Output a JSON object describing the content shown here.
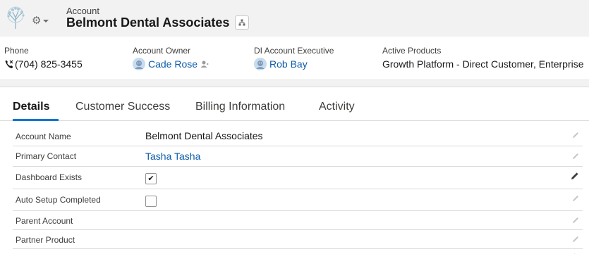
{
  "header": {
    "object_label": "Account",
    "record_title": "Belmont Dental Associates",
    "logo_icon": "tree-logo-icon",
    "settings_icon": "gear-icon",
    "hierarchy_icon": "hierarchy-icon"
  },
  "highlights": {
    "phone": {
      "label": "Phone",
      "value": "(704) 825-3455",
      "icon": "phone-icon"
    },
    "owner": {
      "label": "Account Owner",
      "value": "Cade Rose"
    },
    "executive": {
      "label": "DI Account Executive",
      "value": "Rob Bay"
    },
    "products": {
      "label": "Active Products",
      "value": "Growth Platform - Direct Customer, Enterprise"
    }
  },
  "tabs": [
    {
      "label": "Details",
      "active": true
    },
    {
      "label": "Customer Success",
      "active": false
    },
    {
      "label": "Billing Information",
      "active": false
    },
    {
      "label": "Activity",
      "active": false
    }
  ],
  "fields": [
    {
      "label": "Account Name",
      "value": "Belmont Dental Associates",
      "type": "text"
    },
    {
      "label": "Primary Contact",
      "value": "Tasha Tasha",
      "type": "link"
    },
    {
      "label": "Dashboard Exists",
      "checked": true,
      "type": "checkbox"
    },
    {
      "label": "Auto Setup Completed",
      "checked": false,
      "type": "checkbox"
    },
    {
      "label": "Parent Account",
      "value": "",
      "type": "text"
    },
    {
      "label": "Partner Product",
      "value": "",
      "type": "text"
    }
  ],
  "colors": {
    "brand_blue": "#0176d3",
    "link_blue": "#0b5cab",
    "header_bg": "#f3f2f2"
  }
}
